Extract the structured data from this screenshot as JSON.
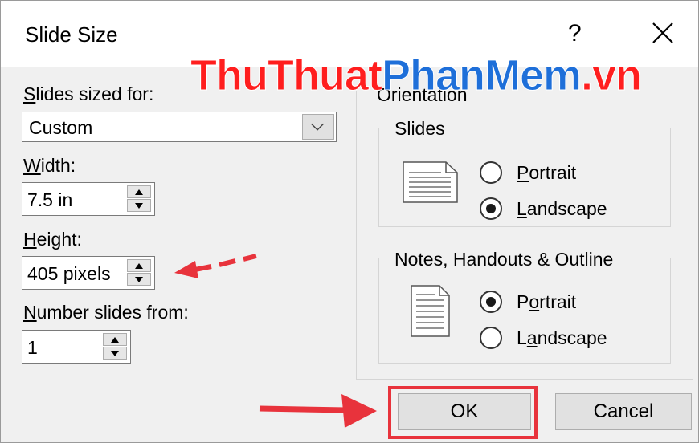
{
  "window": {
    "title": "Slide Size",
    "help_label": "?"
  },
  "watermark": {
    "part_red": "ThuThuat",
    "part_blue": "PhanMem",
    "part_red2": ".vn"
  },
  "left": {
    "sized_for_label_u": "S",
    "sized_for_label_rest": "lides sized for:",
    "sized_for_value": "Custom",
    "width_label_u": "W",
    "width_label_rest": "idth:",
    "width_value": "7.5 in",
    "height_label_u": "H",
    "height_label_rest": "eight:",
    "height_value": "405 pixels",
    "number_label_u": "N",
    "number_label_rest": "umber slides from:",
    "number_value": "1"
  },
  "orientation": {
    "label": "Orientation",
    "slides": {
      "label": "Slides",
      "portrait_u": "P",
      "portrait_rest": "ortrait",
      "landscape_u": "L",
      "landscape_rest": "andscape",
      "selected": "landscape"
    },
    "notes": {
      "label": "Notes, Handouts & Outline",
      "portrait_u": "o",
      "portrait_pre": "P",
      "portrait_rest": "rtrait",
      "landscape_pre": "L",
      "landscape_u": "a",
      "landscape_rest": "ndscape",
      "selected": "portrait"
    }
  },
  "buttons": {
    "ok": "OK",
    "cancel": "Cancel"
  },
  "annotation_color": "#e8333c"
}
